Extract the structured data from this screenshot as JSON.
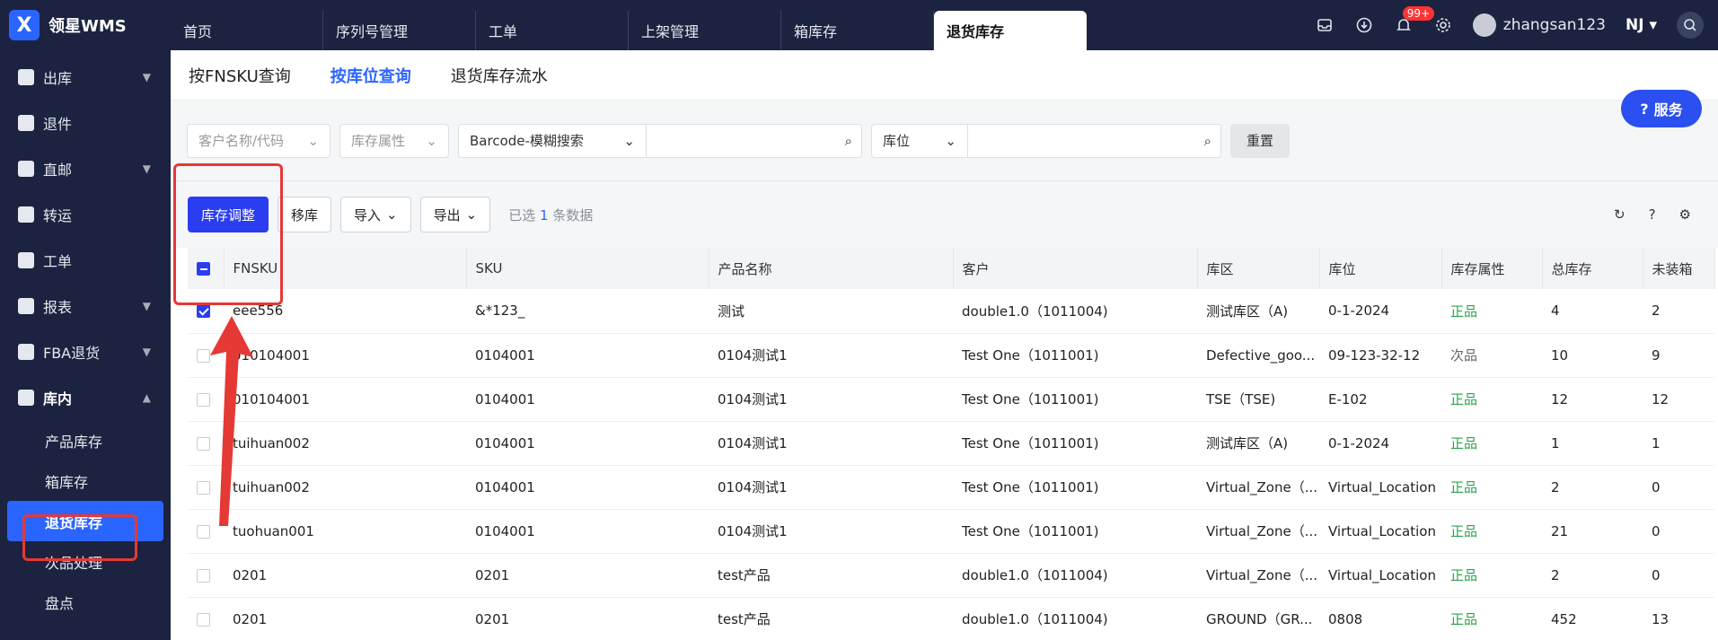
{
  "app": {
    "logo_text": "领星WMS",
    "logo_mark": "X"
  },
  "top_tabs": [
    "首页",
    "序列号管理",
    "工单",
    "上架管理",
    "箱库存",
    "退货库存"
  ],
  "active_top_tab": 5,
  "topbar": {
    "badge": "99+",
    "user": "zhangsan123",
    "site": "NJ"
  },
  "sidebar": {
    "items": [
      {
        "label": "出库",
        "chevron": true
      },
      {
        "label": "退件",
        "chevron": false
      },
      {
        "label": "直邮",
        "chevron": true
      },
      {
        "label": "转运",
        "chevron": false
      },
      {
        "label": "工单",
        "chevron": false
      },
      {
        "label": "报表",
        "chevron": true
      },
      {
        "label": "FBA退货",
        "chevron": true
      },
      {
        "label": "库内",
        "chevron": true
      }
    ],
    "subitems": [
      "产品库存",
      "箱库存",
      "退货库存",
      "次品处理",
      "盘点"
    ]
  },
  "subtabs": [
    "按FNSKU查询",
    "按库位查询",
    "退货库存流水"
  ],
  "filters": {
    "customer_placeholder": "客户名称/代码",
    "attr_placeholder": "库存属性",
    "barcode_mode": "Barcode-模糊搜索",
    "location_mode": "库位",
    "reset": "重置"
  },
  "toolbar": {
    "adjust": "库存调整",
    "move": "移库",
    "import": "导入",
    "export": "导出",
    "selected_prefix": "已选",
    "selected_count": "1",
    "selected_suffix": "条数据"
  },
  "table": {
    "headers": [
      "FNSKU",
      "SKU",
      "产品名称",
      "客户",
      "库区",
      "库位",
      "库存属性",
      "总库存",
      "未装箱"
    ],
    "rows": [
      {
        "checked": true,
        "fnsku": "eee556",
        "sku": "&*123_",
        "name": "测试",
        "customer": "double1.0（1011004)",
        "zone": "测试库区（A)",
        "loc": "0-1-2024",
        "attr": "正品",
        "good": true,
        "total": "4",
        "unboxed": "2"
      },
      {
        "checked": false,
        "fnsku": "010104001",
        "sku": "0104001",
        "name": "0104测试1",
        "customer": "Test One（1011001)",
        "zone": "Defective_goo...",
        "loc": "09-123-32-12",
        "attr": "次品",
        "good": false,
        "total": "10",
        "unboxed": "9"
      },
      {
        "checked": false,
        "fnsku": "010104001",
        "sku": "0104001",
        "name": "0104测试1",
        "customer": "Test One（1011001)",
        "zone": "TSE（TSE)",
        "loc": "E-102",
        "attr": "正品",
        "good": true,
        "total": "12",
        "unboxed": "12"
      },
      {
        "checked": false,
        "fnsku": "tuihuan002",
        "sku": "0104001",
        "name": "0104测试1",
        "customer": "Test One（1011001)",
        "zone": "测试库区（A)",
        "loc": "0-1-2024",
        "attr": "正品",
        "good": true,
        "total": "1",
        "unboxed": "1"
      },
      {
        "checked": false,
        "fnsku": "tuihuan002",
        "sku": "0104001",
        "name": "0104测试1",
        "customer": "Test One（1011001)",
        "zone": "Virtual_Zone（...",
        "loc": "Virtual_Location",
        "attr": "正品",
        "good": true,
        "total": "2",
        "unboxed": "0"
      },
      {
        "checked": false,
        "fnsku": "tuohuan001",
        "sku": "0104001",
        "name": "0104测试1",
        "customer": "Test One（1011001)",
        "zone": "Virtual_Zone（...",
        "loc": "Virtual_Location",
        "attr": "正品",
        "good": true,
        "total": "21",
        "unboxed": "0"
      },
      {
        "checked": false,
        "fnsku": "0201",
        "sku": "0201",
        "name": "test产品",
        "customer": "double1.0（1011004)",
        "zone": "Virtual_Zone（...",
        "loc": "Virtual_Location",
        "attr": "正品",
        "good": true,
        "total": "2",
        "unboxed": "0"
      },
      {
        "checked": false,
        "fnsku": "0201",
        "sku": "0201",
        "name": "test产品",
        "customer": "double1.0（1011004)",
        "zone": "GROUND（GR...",
        "loc": "0808",
        "attr": "正品",
        "good": true,
        "total": "452",
        "unboxed": "13"
      }
    ]
  },
  "service_label": "服务",
  "colors": {
    "accent": "#2b3df0",
    "nav_bg": "#1b2340",
    "annotation": "#e53935",
    "good": "#2aa34a"
  }
}
